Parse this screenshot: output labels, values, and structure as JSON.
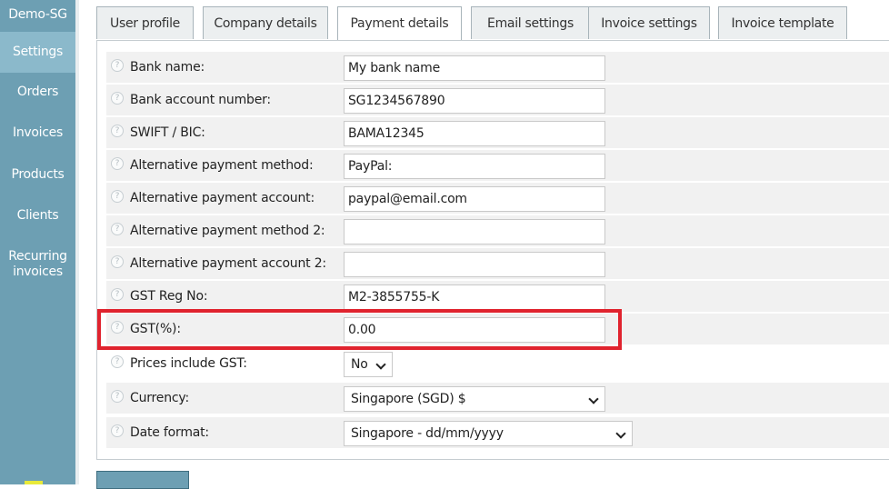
{
  "sidebar": {
    "brand": "Demo-SG",
    "items": [
      {
        "label": "Settings",
        "active": true
      },
      {
        "label": "Orders"
      },
      {
        "label": "Invoices"
      },
      {
        "label": "Products"
      },
      {
        "label": "Clients"
      },
      {
        "label": "Recurring invoices"
      }
    ]
  },
  "tabs": [
    {
      "label": "User profile"
    },
    {
      "label": "Company details"
    },
    {
      "label": "Payment details",
      "active": true
    },
    {
      "label": "Email settings"
    },
    {
      "label": "Invoice settings"
    },
    {
      "label": "Invoice template"
    }
  ],
  "form": {
    "bank_name": {
      "label": "Bank name:",
      "value": "My bank name"
    },
    "bank_account": {
      "label": "Bank account number:",
      "value": "SG1234567890"
    },
    "swift": {
      "label": "SWIFT / BIC:",
      "value": "BAMA12345"
    },
    "alt_method": {
      "label": "Alternative payment method:",
      "value": "PayPal:"
    },
    "alt_account": {
      "label": "Alternative payment account:",
      "value": "paypal@email.com"
    },
    "alt_method_2": {
      "label": "Alternative payment method 2:",
      "value": ""
    },
    "alt_account_2": {
      "label": "Alternative payment account 2:",
      "value": ""
    },
    "gst_reg": {
      "label": "GST Reg No:",
      "value": "M2-3855755-K"
    },
    "gst_percent": {
      "label": "GST(%):",
      "value": "0.00"
    },
    "prices_include_gst": {
      "label": "Prices include GST:",
      "value": "No"
    },
    "currency": {
      "label": "Currency:",
      "value": "Singapore (SGD) $"
    },
    "date_format": {
      "label": "Date format:",
      "value": "Singapore - dd/mm/yyyy"
    }
  },
  "icons": {
    "help": "help-circle-icon"
  },
  "colors": {
    "sidebar": "#6d9fb3",
    "sidebar_active": "#8bb9cb",
    "highlight": "#e0232e"
  }
}
